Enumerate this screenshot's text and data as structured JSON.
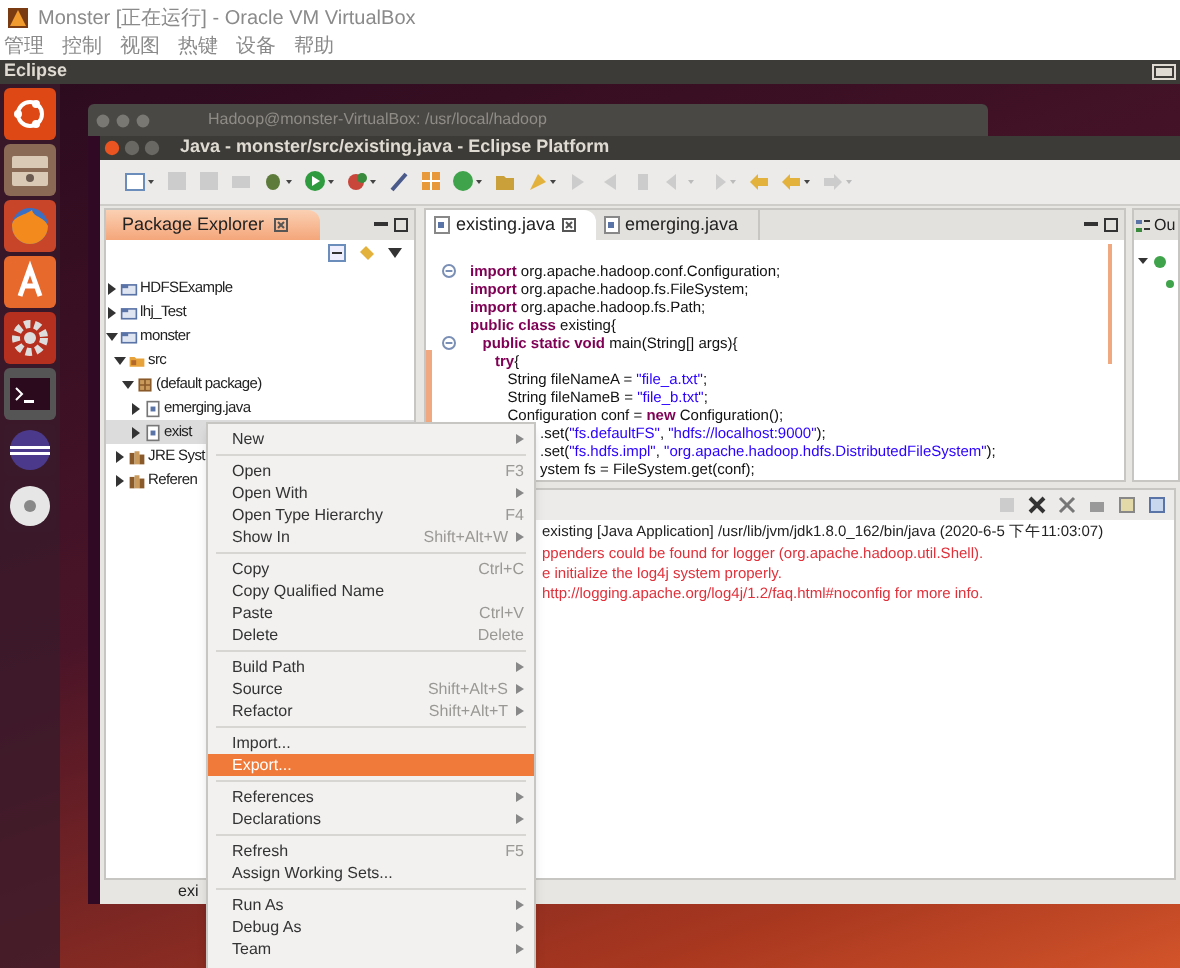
{
  "vbox": {
    "title": "Monster [正在运行] - Oracle VM VirtualBox",
    "menu": [
      "管理",
      "控制",
      "视图",
      "热键",
      "设备",
      "帮助"
    ]
  },
  "top_panel": {
    "title": "Eclipse"
  },
  "terminal": {
    "title": "Hadoop@monster-VirtualBox: /usr/local/hadoop"
  },
  "eclipse": {
    "title": "Java - monster/src/existing.java - Eclipse Platform"
  },
  "package_explorer": {
    "title": "Package Explorer",
    "tree": [
      {
        "label": "HDFSExample",
        "kind": "project",
        "expanded": false,
        "selected": false
      },
      {
        "label": "lhj_Test",
        "kind": "project",
        "expanded": false,
        "selected": false
      },
      {
        "label": "monster",
        "kind": "project",
        "expanded": true,
        "selected": false,
        "children": [
          {
            "label": "src",
            "kind": "folder",
            "expanded": true,
            "selected": false,
            "children": [
              {
                "label": "(default package)",
                "kind": "package",
                "expanded": true,
                "selected": false,
                "children": [
                  {
                    "label": "emerging.java",
                    "kind": "file",
                    "expanded": false,
                    "selected": false
                  },
                  {
                    "label": "exist",
                    "kind": "file",
                    "expanded": false,
                    "selected": true
                  }
                ]
              }
            ]
          },
          {
            "label": "JRE Syst",
            "kind": "library",
            "expanded": false,
            "selected": false
          },
          {
            "label": "Referen",
            "kind": "library",
            "expanded": false,
            "selected": false
          }
        ]
      }
    ]
  },
  "editor": {
    "tabs": [
      {
        "label": "existing.java",
        "selected": true
      },
      {
        "label": "emerging.java",
        "selected": false
      }
    ],
    "lines": [
      {
        "kind": "full",
        "folding": true,
        "segments": [
          {
            "text": "import",
            "kind": "keyword"
          },
          {
            "text": " org.apache.hadoop.conf.Configuration;",
            "kind": "plain"
          }
        ]
      },
      {
        "kind": "full",
        "folding": false,
        "segments": [
          {
            "text": "import",
            "kind": "keyword"
          },
          {
            "text": " org.apache.hadoop.fs.FileSystem;",
            "kind": "plain"
          }
        ]
      },
      {
        "kind": "full",
        "folding": false,
        "segments": [
          {
            "text": "import",
            "kind": "keyword"
          },
          {
            "text": " org.apache.hadoop.fs.Path;",
            "kind": "plain"
          }
        ]
      },
      {
        "kind": "full",
        "folding": false,
        "segments": [
          {
            "text": "public class",
            "kind": "keyword"
          },
          {
            "text": " existing{",
            "kind": "plain"
          }
        ]
      },
      {
        "kind": "full",
        "folding": true,
        "segments": [
          {
            "text": "   public static void",
            "kind": "keyword"
          },
          {
            "text": " main(String[] args){",
            "kind": "plain"
          }
        ]
      },
      {
        "kind": "full",
        "folding": false,
        "segments": [
          {
            "text": "      try",
            "kind": "keyword"
          },
          {
            "text": "{",
            "kind": "plain"
          }
        ]
      },
      {
        "kind": "full",
        "folding": false,
        "segments": [
          {
            "text": "         String fileNameA = ",
            "kind": "plain"
          },
          {
            "text": "\"file_a.txt\"",
            "kind": "string"
          },
          {
            "text": ";",
            "kind": "plain"
          }
        ]
      },
      {
        "kind": "full",
        "folding": false,
        "segments": [
          {
            "text": "         String fileNameB = ",
            "kind": "plain"
          },
          {
            "text": "\"file_b.txt\"",
            "kind": "string"
          },
          {
            "text": ";",
            "kind": "plain"
          }
        ]
      },
      {
        "kind": "full",
        "folding": false,
        "segments": [
          {
            "text": "         Configuration conf = ",
            "kind": "plain"
          },
          {
            "text": "new",
            "kind": "keyword"
          },
          {
            "text": " Configuration();",
            "kind": "plain"
          }
        ]
      },
      {
        "kind": "clipped",
        "folding": false,
        "segments": [
          {
            "text": ".set(",
            "kind": "plain"
          },
          {
            "text": "\"fs.defaultFS\"",
            "kind": "string"
          },
          {
            "text": ", ",
            "kind": "plain"
          },
          {
            "text": "\"hdfs://localhost:9000\"",
            "kind": "string"
          },
          {
            "text": ");",
            "kind": "plain"
          }
        ]
      },
      {
        "kind": "clipped",
        "folding": false,
        "segments": [
          {
            "text": ".set(",
            "kind": "plain"
          },
          {
            "text": "\"fs.hdfs.impl\"",
            "kind": "string"
          },
          {
            "text": ", ",
            "kind": "plain"
          },
          {
            "text": "\"org.apache.hadoop.hdfs.DistributedFileSystem\"",
            "kind": "string"
          },
          {
            "text": ");",
            "kind": "plain"
          }
        ]
      },
      {
        "kind": "clipped",
        "folding": false,
        "segments": [
          {
            "text": "ystem fs = FileSystem.get(conf);",
            "kind": "plain"
          }
        ]
      }
    ]
  },
  "outline": {
    "title": "Ou"
  },
  "console": {
    "header": "existing [Java Application] /usr/lib/jvm/jdk1.8.0_162/bin/java (2020-6-5 下午11:03:07)",
    "lines": [
      "ppenders could be found for logger (org.apache.hadoop.util.Shell).",
      "e initialize the log4j system properly.",
      "http://logging.apache.org/log4j/1.2/faq.html#noconfig for more info."
    ]
  },
  "status_bar": {
    "text": "exi"
  },
  "context_menu": {
    "groups": [
      [
        {
          "label": "New",
          "submenu": true,
          "selected": false
        }
      ],
      [
        {
          "label": "Open",
          "shortcut": "F3",
          "submenu": false,
          "selected": false
        },
        {
          "label": "Open With",
          "submenu": true,
          "selected": false
        },
        {
          "label": "Open Type Hierarchy",
          "shortcut": "F4",
          "submenu": false,
          "selected": false
        },
        {
          "label": "Show In",
          "shortcut": "Shift+Alt+W",
          "submenu": true,
          "selected": false
        }
      ],
      [
        {
          "label": "Copy",
          "shortcut": "Ctrl+C",
          "submenu": false,
          "selected": false
        },
        {
          "label": "Copy Qualified Name",
          "submenu": false,
          "selected": false
        },
        {
          "label": "Paste",
          "shortcut": "Ctrl+V",
          "submenu": false,
          "selected": false
        },
        {
          "label": "Delete",
          "shortcut": "Delete",
          "submenu": false,
          "selected": false
        }
      ],
      [
        {
          "label": "Build Path",
          "submenu": true,
          "selected": false
        },
        {
          "label": "Source",
          "shortcut": "Shift+Alt+S",
          "submenu": true,
          "selected": false
        },
        {
          "label": "Refactor",
          "shortcut": "Shift+Alt+T",
          "submenu": true,
          "selected": false
        }
      ],
      [
        {
          "label": "Import...",
          "submenu": false,
          "selected": false
        },
        {
          "label": "Export...",
          "submenu": false,
          "selected": true
        }
      ],
      [
        {
          "label": "References",
          "submenu": true,
          "selected": false
        },
        {
          "label": "Declarations",
          "submenu": true,
          "selected": false
        }
      ],
      [
        {
          "label": "Refresh",
          "shortcut": "F5",
          "submenu": false,
          "selected": false
        },
        {
          "label": "Assign Working Sets...",
          "submenu": false,
          "selected": false
        }
      ],
      [
        {
          "label": "Run As",
          "submenu": true,
          "selected": false
        },
        {
          "label": "Debug As",
          "submenu": true,
          "selected": false
        },
        {
          "label": "Team",
          "submenu": true,
          "selected": false
        }
      ]
    ]
  }
}
